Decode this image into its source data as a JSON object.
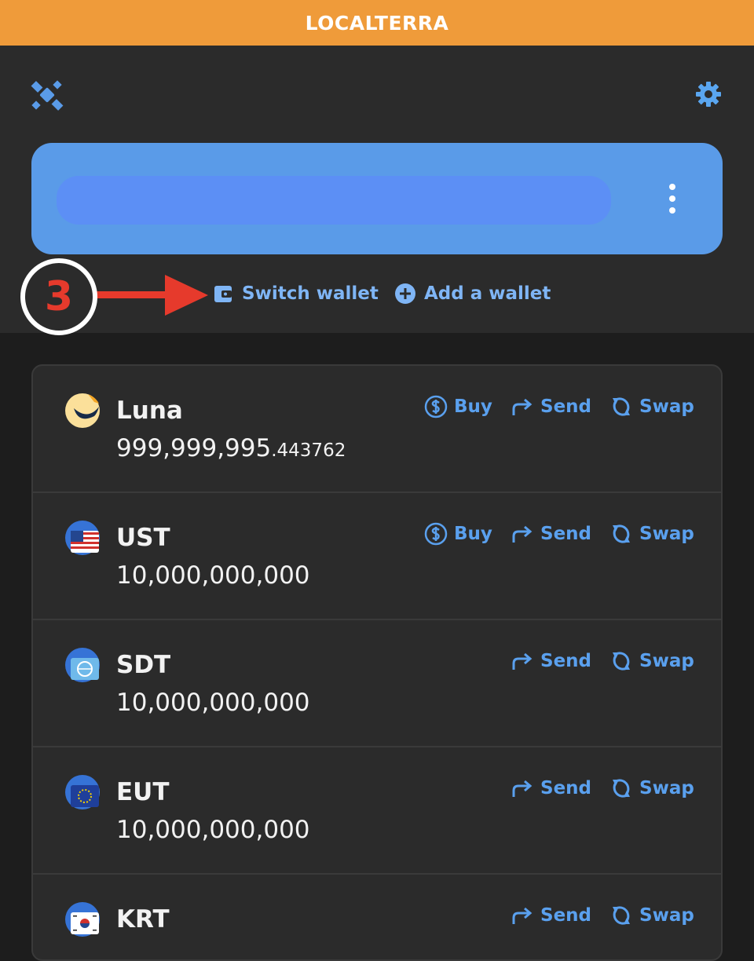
{
  "network": {
    "name": "LOCALTERRA",
    "color": "#ef9b3a"
  },
  "header": {
    "settings_icon": "gear-icon",
    "network_icon": "satellite-icon"
  },
  "wallet": {
    "accent": "#5a9be8"
  },
  "wallet_actions": {
    "switch_label": "Switch wallet",
    "add_label": "Add a wallet"
  },
  "annotation": {
    "step_number": "3"
  },
  "assets": [
    {
      "symbol": "Luna",
      "amount_whole": "999,999,995",
      "amount_decimal": ".443762",
      "icon": "luna-icon",
      "actions": {
        "buy": "Buy",
        "send": "Send",
        "swap": "Swap"
      }
    },
    {
      "symbol": "UST",
      "amount_whole": "10,000,000,000",
      "amount_decimal": "",
      "icon": "ust-flag-icon",
      "actions": {
        "buy": "Buy",
        "send": "Send",
        "swap": "Swap"
      }
    },
    {
      "symbol": "SDT",
      "amount_whole": "10,000,000,000",
      "amount_decimal": "",
      "icon": "sdt-imf-icon",
      "actions": {
        "send": "Send",
        "swap": "Swap"
      }
    },
    {
      "symbol": "EUT",
      "amount_whole": "10,000,000,000",
      "amount_decimal": "",
      "icon": "eut-eu-flag-icon",
      "actions": {
        "send": "Send",
        "swap": "Swap"
      }
    },
    {
      "symbol": "KRT",
      "amount_whole": "",
      "amount_decimal": "",
      "icon": "krt-kr-flag-icon",
      "actions": {
        "send": "Send",
        "swap": "Swap"
      }
    }
  ]
}
